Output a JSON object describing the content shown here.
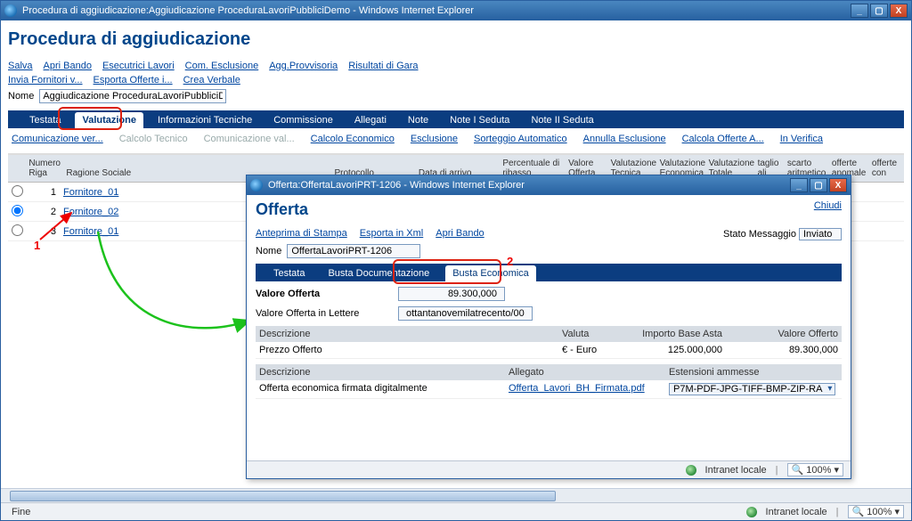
{
  "outer_window": {
    "title": "Procedura di aggiudicazione:Aggiudicazione ProceduraLavoriPubbliciDemo - Windows Internet Explorer"
  },
  "page": {
    "heading": "Procedura di aggiudicazione",
    "links_row1": [
      "Salva",
      "Apri Bando",
      "Esecutrici Lavori",
      "Com. Esclusione",
      "Agg.Provvisoria",
      "Risultati di Gara"
    ],
    "links_row2": [
      "Invia Fornitori v...",
      "Esporta Offerte i...",
      "Crea Verbale"
    ],
    "nome_label": "Nome",
    "nome_value": "Aggiudicazione ProceduraLavoriPubbliciD"
  },
  "tabs": [
    "Testata",
    "Valutazione",
    "Informazioni Tecniche",
    "Commissione",
    "Allegati",
    "Note",
    "Note I Seduta",
    "Note II Seduta"
  ],
  "tabs_active_index": 1,
  "sub_links": [
    {
      "label": "Comunicazione ver...",
      "enabled": true
    },
    {
      "label": "Calcolo Tecnico",
      "enabled": false
    },
    {
      "label": "Comunicazione val...",
      "enabled": false
    },
    {
      "label": "Calcolo Economico",
      "enabled": true
    },
    {
      "label": "Esclusione",
      "enabled": true
    },
    {
      "label": "Sorteggio Automatico",
      "enabled": true
    },
    {
      "label": "Annulla Esclusione",
      "enabled": true
    },
    {
      "label": "Calcola Offerte A...",
      "enabled": true
    },
    {
      "label": "In Verifica",
      "enabled": true
    }
  ],
  "grid": {
    "headers": {
      "num": "Numero Riga",
      "ragione": "Ragione Sociale",
      "protocollo": "Protocollo",
      "data": "Data di arrivo",
      "perc": "Percentuale di ribasso",
      "valore": "Valore Offerta",
      "vt": "Valutazione Tecnica",
      "ve": "Valutazione Economica",
      "vtot": "Valutazione Totale",
      "taglio": "taglio ali",
      "scarto": "scarto aritmetico",
      "anom": "offerte anomale",
      "con": "offerte con"
    },
    "rows": [
      {
        "n": "1",
        "name": "Fornitore_01"
      },
      {
        "n": "2",
        "name": "Fornitore_02"
      },
      {
        "n": "3",
        "name": "Fornitore_01"
      }
    ]
  },
  "annotation": {
    "one": "1",
    "two": "2"
  },
  "popup": {
    "title": "Offerta:OffertaLavoriPRT-1206 - Windows Internet Explorer",
    "heading": "Offerta",
    "chiudi": "Chiudi",
    "links": [
      "Anteprima di Stampa",
      "Esporta in Xml",
      "Apri Bando"
    ],
    "stato_label": "Stato Messaggio",
    "stato_value": "Inviato",
    "nome_label": "Nome",
    "nome_value": "OffertaLavoriPRT-1206",
    "tabs": [
      "Testata",
      "Busta Documentazione",
      "Busta Economica"
    ],
    "tabs_active_index": 2,
    "valore_offerta_label": "Valore Offerta",
    "valore_offerta_value": "89.300,000",
    "valore_lettere_label": "Valore Offerta in Lettere",
    "valore_lettere_value": "ottantanovemilatrecento/00",
    "table1": {
      "headers": {
        "desc": "Descrizione",
        "valuta": "Valuta",
        "base": "Importo Base Asta",
        "off": "Valore Offerto"
      },
      "row": {
        "desc": "Prezzo Offerto",
        "valuta": "€ - Euro",
        "base": "125.000,000",
        "off": "89.300,000"
      }
    },
    "table2": {
      "headers": {
        "desc": "Descrizione",
        "allegato": "Allegato",
        "ext": "Estensioni ammesse"
      },
      "row": {
        "desc": "Offerta economica firmata digitalmente",
        "allegato": "Offerta_Lavori_BH_Firmata.pdf",
        "ext": "P7M-PDF-JPG-TIFF-BMP-ZIP-RA"
      }
    },
    "status_zone": "Intranet locale",
    "zoom": "100%"
  },
  "outer_status": {
    "fine": "Fine",
    "zone": "Intranet locale",
    "zoom": "100%"
  }
}
